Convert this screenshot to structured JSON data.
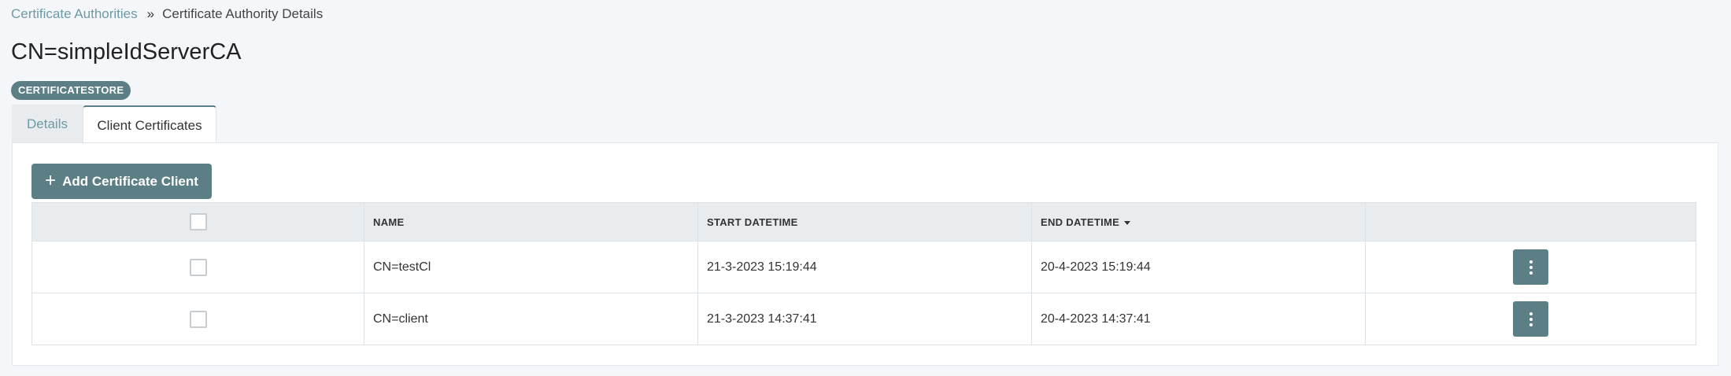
{
  "breadcrumb": {
    "parent": "Certificate Authorities",
    "separator": "»",
    "current": "Certificate Authority Details"
  },
  "page": {
    "title": "CN=simpleIdServerCA",
    "badge": "CERTIFICATESTORE"
  },
  "tabs": [
    {
      "label": "Details",
      "active": false
    },
    {
      "label": "Client Certificates",
      "active": true
    }
  ],
  "toolbar": {
    "add_icon": "plus-icon",
    "add_label": "Add Certificate Client"
  },
  "table": {
    "columns": [
      "",
      "NAME",
      "START DATETIME",
      "END DATETIME",
      ""
    ],
    "sorted_column": "END DATETIME",
    "sort_direction": "descending",
    "rows": [
      {
        "name": "CN=testCl",
        "start": "21-3-2023 15:19:44",
        "end": "20-4-2023 15:19:44"
      },
      {
        "name": "CN=client",
        "start": "21-3-2023 14:37:41",
        "end": "20-4-2023 14:37:41"
      }
    ]
  },
  "colors": {
    "accent": "#5b7f85",
    "link": "#6d9aa6",
    "background": "#f4f6f9",
    "header_bg": "#e9ecef"
  }
}
